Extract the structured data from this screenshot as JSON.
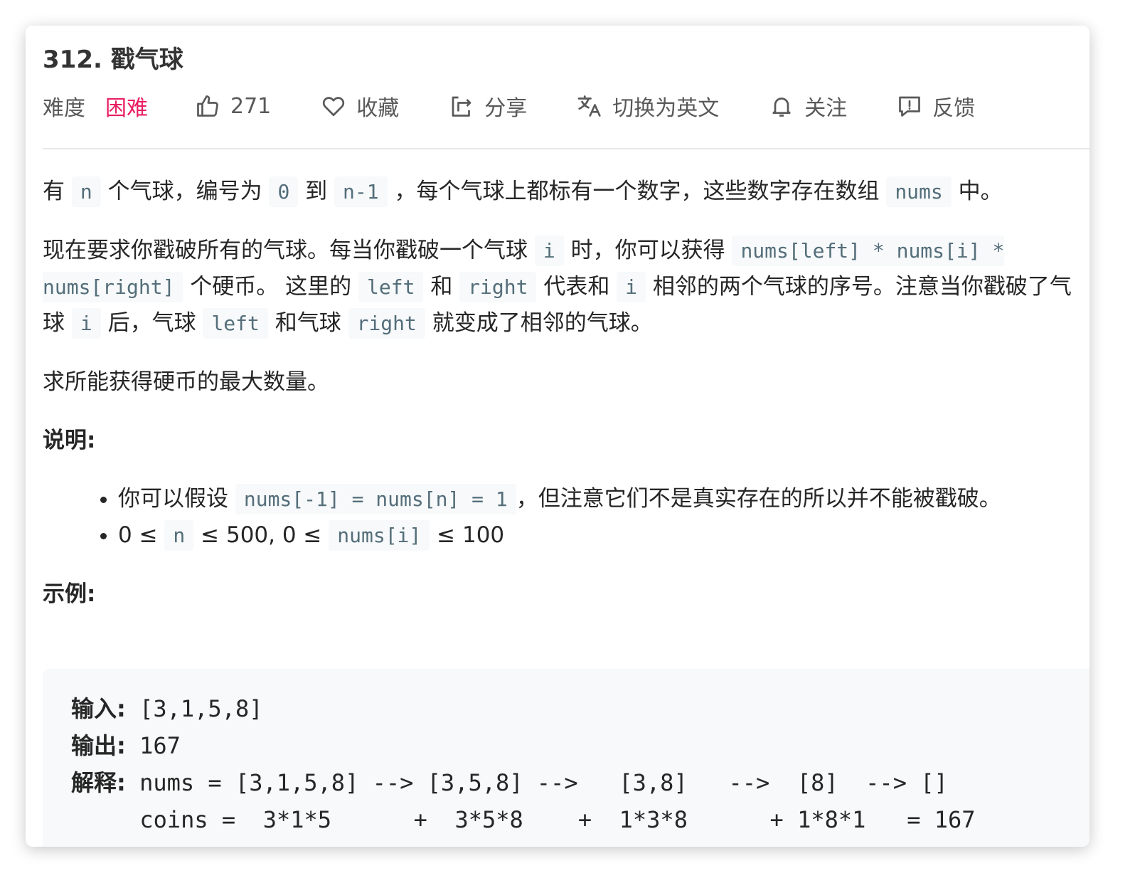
{
  "problem": {
    "title": "312. 戳气球"
  },
  "toolbar": {
    "difficulty_label": "难度",
    "difficulty_value": "困难",
    "difficulty_color": "#e91e63",
    "likes": "271",
    "favorite": "收藏",
    "share": "分享",
    "switch_lang": "切换为英文",
    "follow": "关注",
    "feedback": "反馈",
    "icons": [
      "thumbs-up-icon",
      "heart-icon",
      "share-icon",
      "translate-icon",
      "bell-icon",
      "feedback-icon"
    ]
  },
  "description": {
    "p1": [
      "有",
      "n",
      "个气球，编号为",
      "0",
      "到",
      "n-1",
      "，每个气球上都标有一个数字，这些数字存在数组",
      "nums",
      "中。"
    ],
    "p2": [
      "现在要求你戳破所有的气球。每当你戳破一个气球",
      "i",
      "时，你可以获得",
      "nums[left] * nums[i] * nums[right]",
      "个硬币。 这里的",
      "left",
      "和",
      "right",
      "代表和",
      "i",
      "相邻的两个气球的序号。注意当你戳破了气球",
      "i",
      "后，气球",
      "left",
      "和气球",
      "right",
      "就变成了相邻的气球。"
    ],
    "p3": "求所能获得硬币的最大数量。",
    "notes_heading": "说明:",
    "note1": [
      "你可以假设",
      "nums[-1] = nums[n] = 1",
      "，但注意它们不是真实存在的所以并不能被戳破。"
    ],
    "note2": [
      "0 ≤",
      "n",
      "≤ 500, 0 ≤",
      "nums[i]",
      "≤ 100"
    ],
    "example_heading": "示例:"
  },
  "example": {
    "input_label": "输入:",
    "input_value": " [3,1,5,8]",
    "output_label": "输出:",
    "output_value": " 167",
    "explain_label": "解释:",
    "explain_line1": " nums = [3,1,5,8] --> [3,5,8] -->   [3,8]   -->  [8]  --> []",
    "explain_line2": "     coins =  3*1*5      +  3*5*8    +  1*3*8      + 1*8*1   = 167"
  }
}
